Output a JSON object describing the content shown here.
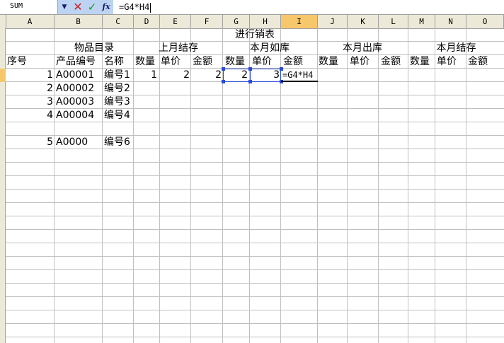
{
  "formula_bar": {
    "name_box": "SUM",
    "dropdown_icon": "chevron-down-icon",
    "cancel_icon": "cancel-x-icon",
    "enter_icon": "checkmark-icon",
    "fx_label": "fx",
    "formula": "=G4*H4"
  },
  "columns": [
    "A",
    "B",
    "C",
    "D",
    "E",
    "F",
    "G",
    "H",
    "I",
    "J",
    "K",
    "L",
    "M",
    "N",
    "O"
  ],
  "active_column": "I",
  "sheet": {
    "title": "进行销表",
    "groups": {
      "catalog": "物品目录",
      "prev_month": "上月结存",
      "inbound": "本月如库",
      "outbound": "本月出库",
      "balance": "本月结存"
    },
    "headers": {
      "seq": "序号",
      "code": "产品编号",
      "name": "名称",
      "qty1": "数量",
      "price1": "单价",
      "amt1": "金额",
      "qty2": "数量",
      "price2": "单价",
      "amt2": "金额",
      "qty3": "数量",
      "price3": "单价",
      "amt3": "金额",
      "qty4": "数量",
      "price4": "单价",
      "amt4": "金额"
    },
    "rows": [
      {
        "seq": "1",
        "code": "A00001",
        "name": "编号1",
        "qty": "1",
        "price": "2",
        "amount": "2",
        "in_qty": "2",
        "in_price": "3",
        "in_amount": "=G4*H4"
      },
      {
        "seq": "2",
        "code": "A00002",
        "name": "编号2"
      },
      {
        "seq": "3",
        "code": "A00003",
        "name": "编号3"
      },
      {
        "seq": "4",
        "code": "A00004",
        "name": "编号4"
      },
      {
        "seq": "5",
        "code": "A0000",
        "name": "编号6"
      }
    ]
  },
  "colors": {
    "selection_border": "#2a4bd7",
    "active_header": "#f7c76b",
    "toolbar_buttons_bg": "#bcd3f2",
    "cancel_red": "#cc1f1f",
    "enter_green": "#1f9a1f"
  }
}
